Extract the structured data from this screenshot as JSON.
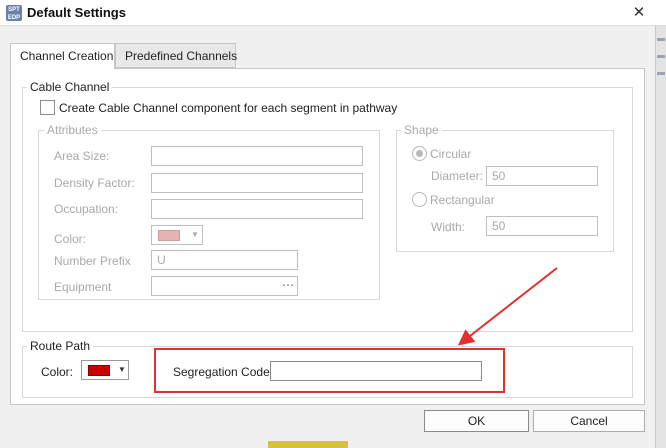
{
  "window": {
    "title": "Default Settings",
    "icon_text": "SPT EDP",
    "close_glyph": "✕"
  },
  "tabs": [
    {
      "label": "Channel Creation",
      "selected": true
    },
    {
      "label": "Predefined Channels",
      "selected": false
    }
  ],
  "cable_channel": {
    "legend": "Cable Channel",
    "checkbox_label": "Create Cable Channel component for each segment in pathway",
    "checked": false,
    "attributes": {
      "legend": "Attributes",
      "area_size_label": "Area Size:",
      "area_size_value": "",
      "density_factor_label": "Density Factor:",
      "density_factor_value": "",
      "occupation_label": "Occupation:",
      "occupation_value": "",
      "color_label": "Color:",
      "color_value": "#e6b3b3",
      "number_prefix_label": "Number Prefix",
      "number_prefix_value": "U",
      "equipment_label": "Equipment",
      "equipment_value": "",
      "equipment_button": "⋯"
    },
    "shape": {
      "legend": "Shape",
      "circular_label": "Circular",
      "circular_selected": true,
      "diameter_label": "Diameter:",
      "diameter_value": "50",
      "rectangular_label": "Rectangular",
      "rectangular_selected": false,
      "width_label": "Width:",
      "width_value": "50"
    }
  },
  "route_path": {
    "legend": "Route Path",
    "color_label": "Color:",
    "color_value": "#cc0000",
    "segregation_code_label": "Segregation Code:",
    "segregation_code_value": ""
  },
  "buttons": {
    "ok": "OK",
    "cancel": "Cancel"
  },
  "colors": {
    "annotation": "#e03030"
  }
}
